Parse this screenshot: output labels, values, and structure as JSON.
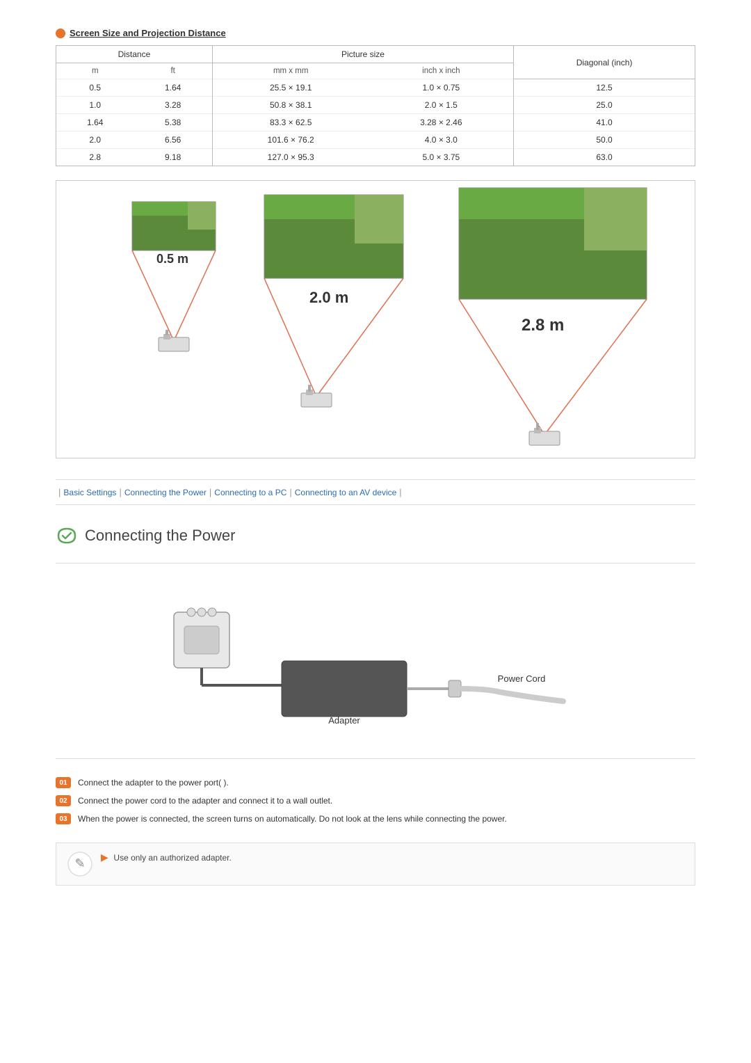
{
  "screen_size_section": {
    "icon_color": "#e8732a",
    "title": "Screen Size and Projection Distance",
    "table": {
      "headers": {
        "distance": "Distance",
        "picture_size": "Picture size",
        "diagonal": "Diagonal (inch)"
      },
      "subheaders": {
        "m": "m",
        "ft": "ft",
        "mm_x_mm": "mm x mm",
        "inch_x_inch": "inch x inch"
      },
      "rows": [
        {
          "m": "0.5",
          "ft": "1.64",
          "mm_x_mm": "25.5 × 19.1",
          "inch_x_inch": "1.0 × 0.75",
          "diagonal": "12.5"
        },
        {
          "m": "1.0",
          "ft": "3.28",
          "mm_x_mm": "50.8 × 38.1",
          "inch_x_inch": "2.0 × 1.5",
          "diagonal": "25.0"
        },
        {
          "m": "1.64",
          "ft": "5.38",
          "mm_x_mm": "83.3 × 62.5",
          "inch_x_inch": "3.28 × 2.46",
          "diagonal": "41.0"
        },
        {
          "m": "2.0",
          "ft": "6.56",
          "mm_x_mm": "101.6 × 76.2",
          "inch_x_inch": "4.0 × 3.0",
          "diagonal": "50.0"
        },
        {
          "m": "2.8",
          "ft": "9.18",
          "mm_x_mm": "127.0 × 95.3",
          "inch_x_inch": "5.0 × 3.75",
          "diagonal": "63.0"
        }
      ]
    }
  },
  "projection_diagram": {
    "distances": [
      "0.5 m",
      "2.0 m",
      "2.8 m"
    ]
  },
  "navigation": {
    "items": [
      "Basic Settings",
      "Connecting the Power",
      "Connecting to a PC",
      "Connecting to an AV device"
    ]
  },
  "connecting_power": {
    "title": "Connecting the Power",
    "diagram": {
      "adapter_label": "Adapter",
      "power_cord_label": "Power Cord"
    },
    "steps": [
      {
        "num": "01",
        "text": "Connect the adapter to the power port(   )."
      },
      {
        "num": "02",
        "text": "Connect the power cord to the adapter and connect it to a wall outlet."
      },
      {
        "num": "03",
        "text": "When the power is connected, the screen turns on automatically. Do not look at the lens while connecting the power."
      }
    ],
    "note": {
      "text": "Use only an authorized adapter."
    }
  }
}
